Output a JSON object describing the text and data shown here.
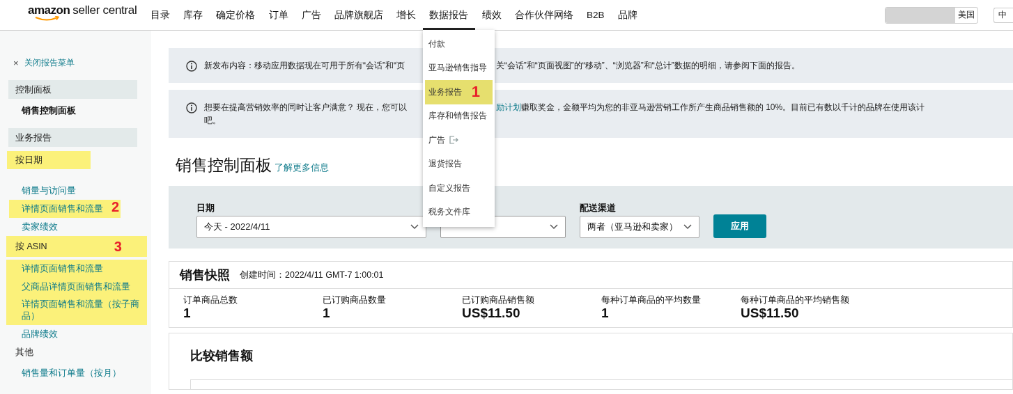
{
  "header": {
    "logo": {
      "brand": "amazon",
      "product": "seller central"
    },
    "nav": [
      {
        "label": "目录",
        "selected": false
      },
      {
        "label": "库存",
        "selected": false
      },
      {
        "label": "确定价格",
        "selected": false
      },
      {
        "label": "订单",
        "selected": false
      },
      {
        "label": "广告",
        "selected": false
      },
      {
        "label": "品牌旗舰店",
        "selected": false
      },
      {
        "label": "增长",
        "selected": false
      },
      {
        "label": "数据报告",
        "selected": true
      },
      {
        "label": "绩效",
        "selected": false
      },
      {
        "label": "合作伙伴网络",
        "selected": false
      },
      {
        "label": "B2B",
        "selected": false
      },
      {
        "label": "品牌",
        "selected": false
      }
    ],
    "marketplace": "美国",
    "language": "中"
  },
  "reports_menu": [
    {
      "label": "付款",
      "kind": "plain",
      "highlighted": false
    },
    {
      "label": "亚马逊销售指导",
      "kind": "plain",
      "highlighted": false
    },
    {
      "label": "业务报告",
      "kind": "plain",
      "highlighted": true,
      "annotation": "1"
    },
    {
      "label": "库存和销售报告",
      "kind": "plain",
      "highlighted": false
    },
    {
      "label": "广告",
      "kind": "external",
      "highlighted": false
    },
    {
      "label": "退货报告",
      "kind": "plain",
      "highlighted": false
    },
    {
      "label": "自定义报告",
      "kind": "plain",
      "highlighted": false
    },
    {
      "label": "税务文件库",
      "kind": "plain",
      "highlighted": false
    }
  ],
  "sidebar": {
    "close_icon": "×",
    "close_label": "关闭报告菜单",
    "sections": [
      {
        "title": "控制面板",
        "groups": [
          {
            "children": [
              {
                "label": "销售控制面板",
                "selected": true,
                "highlighted": false
              }
            ]
          }
        ]
      },
      {
        "title": "业务报告",
        "groups": [
          {
            "label": "按日期",
            "highlighted": true,
            "children": [
              {
                "label": "销量与访问量",
                "selected": false,
                "highlighted": false
              },
              {
                "label": "详情页面销售和流量",
                "selected": false,
                "highlighted": true,
                "annotation": "2"
              },
              {
                "label": "卖家绩效",
                "selected": false,
                "highlighted": false
              }
            ]
          },
          {
            "label": "按 ASIN",
            "highlighted": true,
            "annotation": "3",
            "children": [
              {
                "label": "详情页面销售和流量",
                "selected": false,
                "highlighted": true
              },
              {
                "label": "父商品详情页面销售和流量",
                "selected": false,
                "highlighted": true
              },
              {
                "label": "详情页面销售和流量（按子商品）",
                "selected": false,
                "highlighted": true
              },
              {
                "label": "品牌绩效",
                "selected": false,
                "highlighted": false
              }
            ]
          },
          {
            "label": "其他",
            "highlighted": false,
            "children": [
              {
                "label": "销售量和订单量（按月）",
                "selected": false,
                "highlighted": false
              }
            ]
          }
        ]
      }
    ]
  },
  "banners": [
    {
      "lines": [
        {
          "before": "新发布内容：移动应用数据现在可用于所有“会话”和“页",
          "after": "关“会话”和“页面视图”的“移动”、“浏览器”和“总计”数据的明细，请参阅下面的报告。"
        }
      ]
    },
    {
      "lines": [
        {
          "before": "想要在提高营销效率的同时让客户满意？ 现在，您可以",
          "link": "励计划",
          "after": " 赚取奖金，金额平均为您的非亚马逊营销工作所产生商品销售额的 10%。目前已有数以千计的品牌在使用该计"
        },
        {
          "before": "吧。"
        }
      ]
    }
  ],
  "page": {
    "title": "销售控制面板",
    "learn_more": "了解更多信息"
  },
  "filters": {
    "fields": [
      {
        "label": "日期",
        "value": "今天 - 2022/4/11"
      },
      {
        "kind": "covered"
      },
      {
        "label": "配送渠道",
        "value": "两者（亚马逊和卖家）"
      }
    ],
    "apply": "应用"
  },
  "snapshot": {
    "title": "销售快照",
    "created": "创建时间：2022/4/11 GMT-7 1:00:01",
    "metrics": [
      {
        "label": "订单商品总数",
        "value": "1"
      },
      {
        "label": "已订购商品数量",
        "value": "1"
      },
      {
        "label": "已订购商品销售额",
        "value": "US$11.50"
      },
      {
        "label": "每种订单商品的平均数量",
        "value": "1"
      },
      {
        "label": "每种订单商品的平均销售额",
        "value": "US$11.50"
      }
    ]
  },
  "compare": {
    "title": "比较销售额"
  }
}
